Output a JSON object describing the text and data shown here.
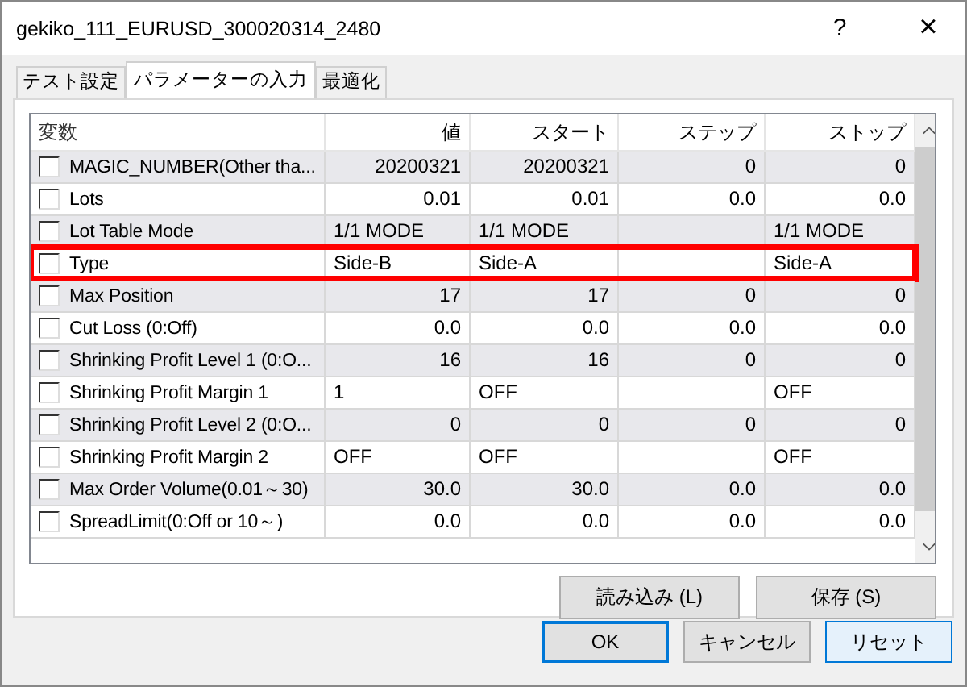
{
  "window": {
    "title": "gekiko_111_EURUSD_300020314_2480",
    "help": "?",
    "close": "×"
  },
  "tabs": [
    {
      "label": "テスト設定",
      "selected": false
    },
    {
      "label": "パラメーターの入力",
      "selected": true
    },
    {
      "label": "最適化",
      "selected": false
    }
  ],
  "table": {
    "columns": [
      "変数",
      "値",
      "スタート",
      "ステップ",
      "ストップ"
    ],
    "rows": [
      {
        "kind": "number",
        "checked": false,
        "highlighted": false,
        "cells": [
          "MAGIC_NUMBER(Other tha...",
          "20200321",
          "20200321",
          "0",
          "0"
        ]
      },
      {
        "kind": "number",
        "checked": false,
        "highlighted": false,
        "cells": [
          "Lots",
          "0.01",
          "0.01",
          "0.0",
          "0.0"
        ]
      },
      {
        "kind": "text",
        "checked": false,
        "highlighted": false,
        "cells": [
          "Lot Table Mode",
          "1/1 MODE",
          "1/1 MODE",
          "",
          "1/1 MODE"
        ]
      },
      {
        "kind": "text",
        "checked": false,
        "highlighted": true,
        "cells": [
          "Type",
          "Side-B",
          "Side-A",
          "",
          "Side-A"
        ]
      },
      {
        "kind": "number",
        "checked": false,
        "highlighted": false,
        "cells": [
          "Max Position",
          "17",
          "17",
          "0",
          "0"
        ]
      },
      {
        "kind": "number",
        "checked": false,
        "highlighted": false,
        "cells": [
          "Cut Loss (0:Off)",
          "0.0",
          "0.0",
          "0.0",
          "0.0"
        ]
      },
      {
        "kind": "number",
        "checked": false,
        "highlighted": false,
        "cells": [
          "Shrinking Profit Level 1 (0:O...",
          "16",
          "16",
          "0",
          "0"
        ]
      },
      {
        "kind": "text",
        "checked": false,
        "highlighted": false,
        "cells": [
          "Shrinking Profit Margin 1",
          "1",
          "OFF",
          "",
          "OFF"
        ]
      },
      {
        "kind": "number",
        "checked": false,
        "highlighted": false,
        "cells": [
          "Shrinking Profit Level 2 (0:O...",
          "0",
          "0",
          "0",
          "0"
        ]
      },
      {
        "kind": "text",
        "checked": false,
        "highlighted": false,
        "cells": [
          "Shrinking Profit Margin 2",
          "OFF",
          "OFF",
          "",
          "OFF"
        ]
      },
      {
        "kind": "number",
        "checked": false,
        "highlighted": false,
        "cells": [
          "Max Order Volume(0.01～30)",
          "30.0",
          "30.0",
          "0.0",
          "0.0"
        ]
      },
      {
        "kind": "number",
        "checked": false,
        "highlighted": false,
        "cells": [
          "SpreadLimit(0:Off or 10～)",
          "0.0",
          "0.0",
          "0.0",
          "0.0"
        ]
      }
    ]
  },
  "panel_buttons": [
    "読み込み (L)",
    "保存 (S)"
  ],
  "buttons": [
    {
      "label": "OK",
      "kind": "default"
    },
    {
      "label": "キャンセル",
      "kind": "normal"
    },
    {
      "label": "リセット",
      "kind": "hover"
    }
  ]
}
